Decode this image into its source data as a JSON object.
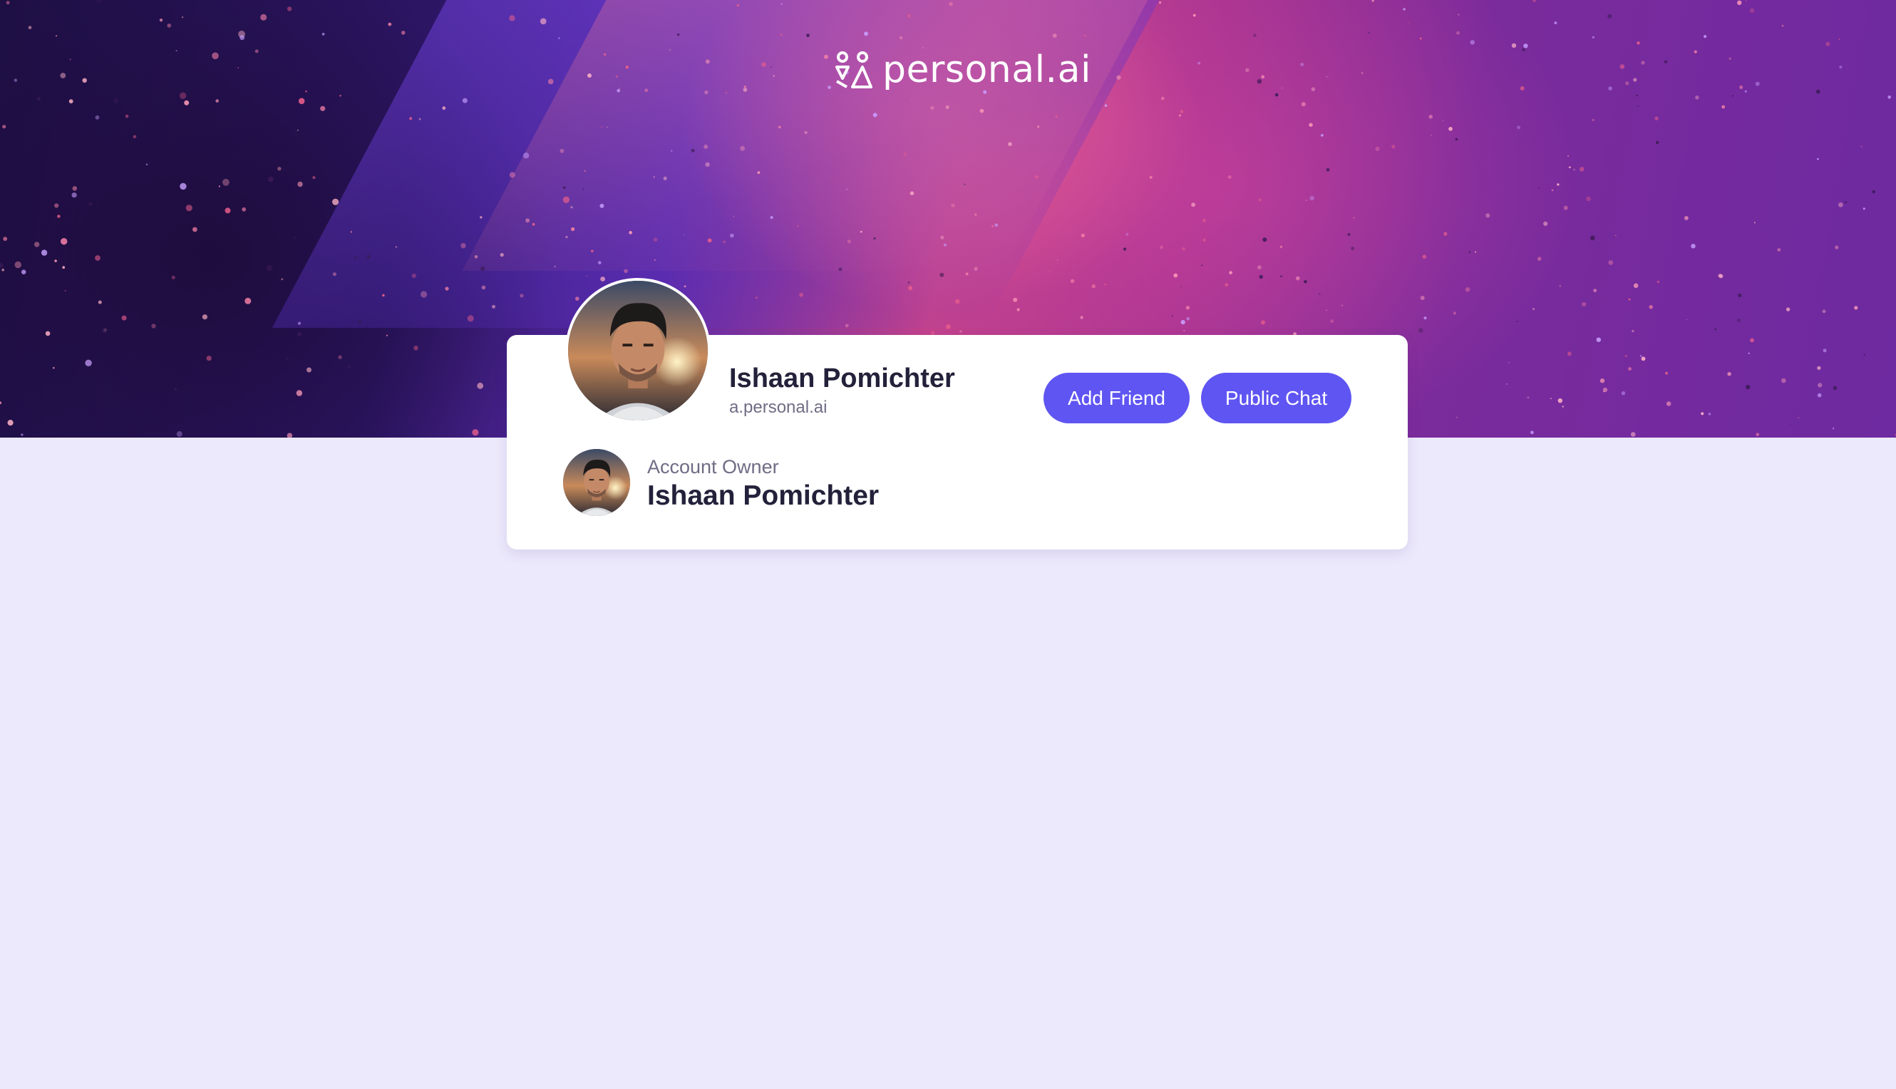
{
  "brand": {
    "logo_text": "personal.ai",
    "logo_icon": "people-triangle-logo-icon"
  },
  "profile": {
    "name": "Ishaan Pomichter",
    "handle": "a.personal.ai",
    "avatar_icon": "profile-avatar"
  },
  "actions": {
    "add_friend_label": "Add Friend",
    "public_chat_label": "Public Chat"
  },
  "owner": {
    "label": "Account Owner",
    "name": "Ishaan Pomichter",
    "avatar_icon": "owner-avatar"
  },
  "colors": {
    "accent": "#5f55f2",
    "page_background": "#ede9fc",
    "card_background": "#ffffff",
    "text_primary": "#23213a",
    "text_secondary": "#6f6c85"
  }
}
